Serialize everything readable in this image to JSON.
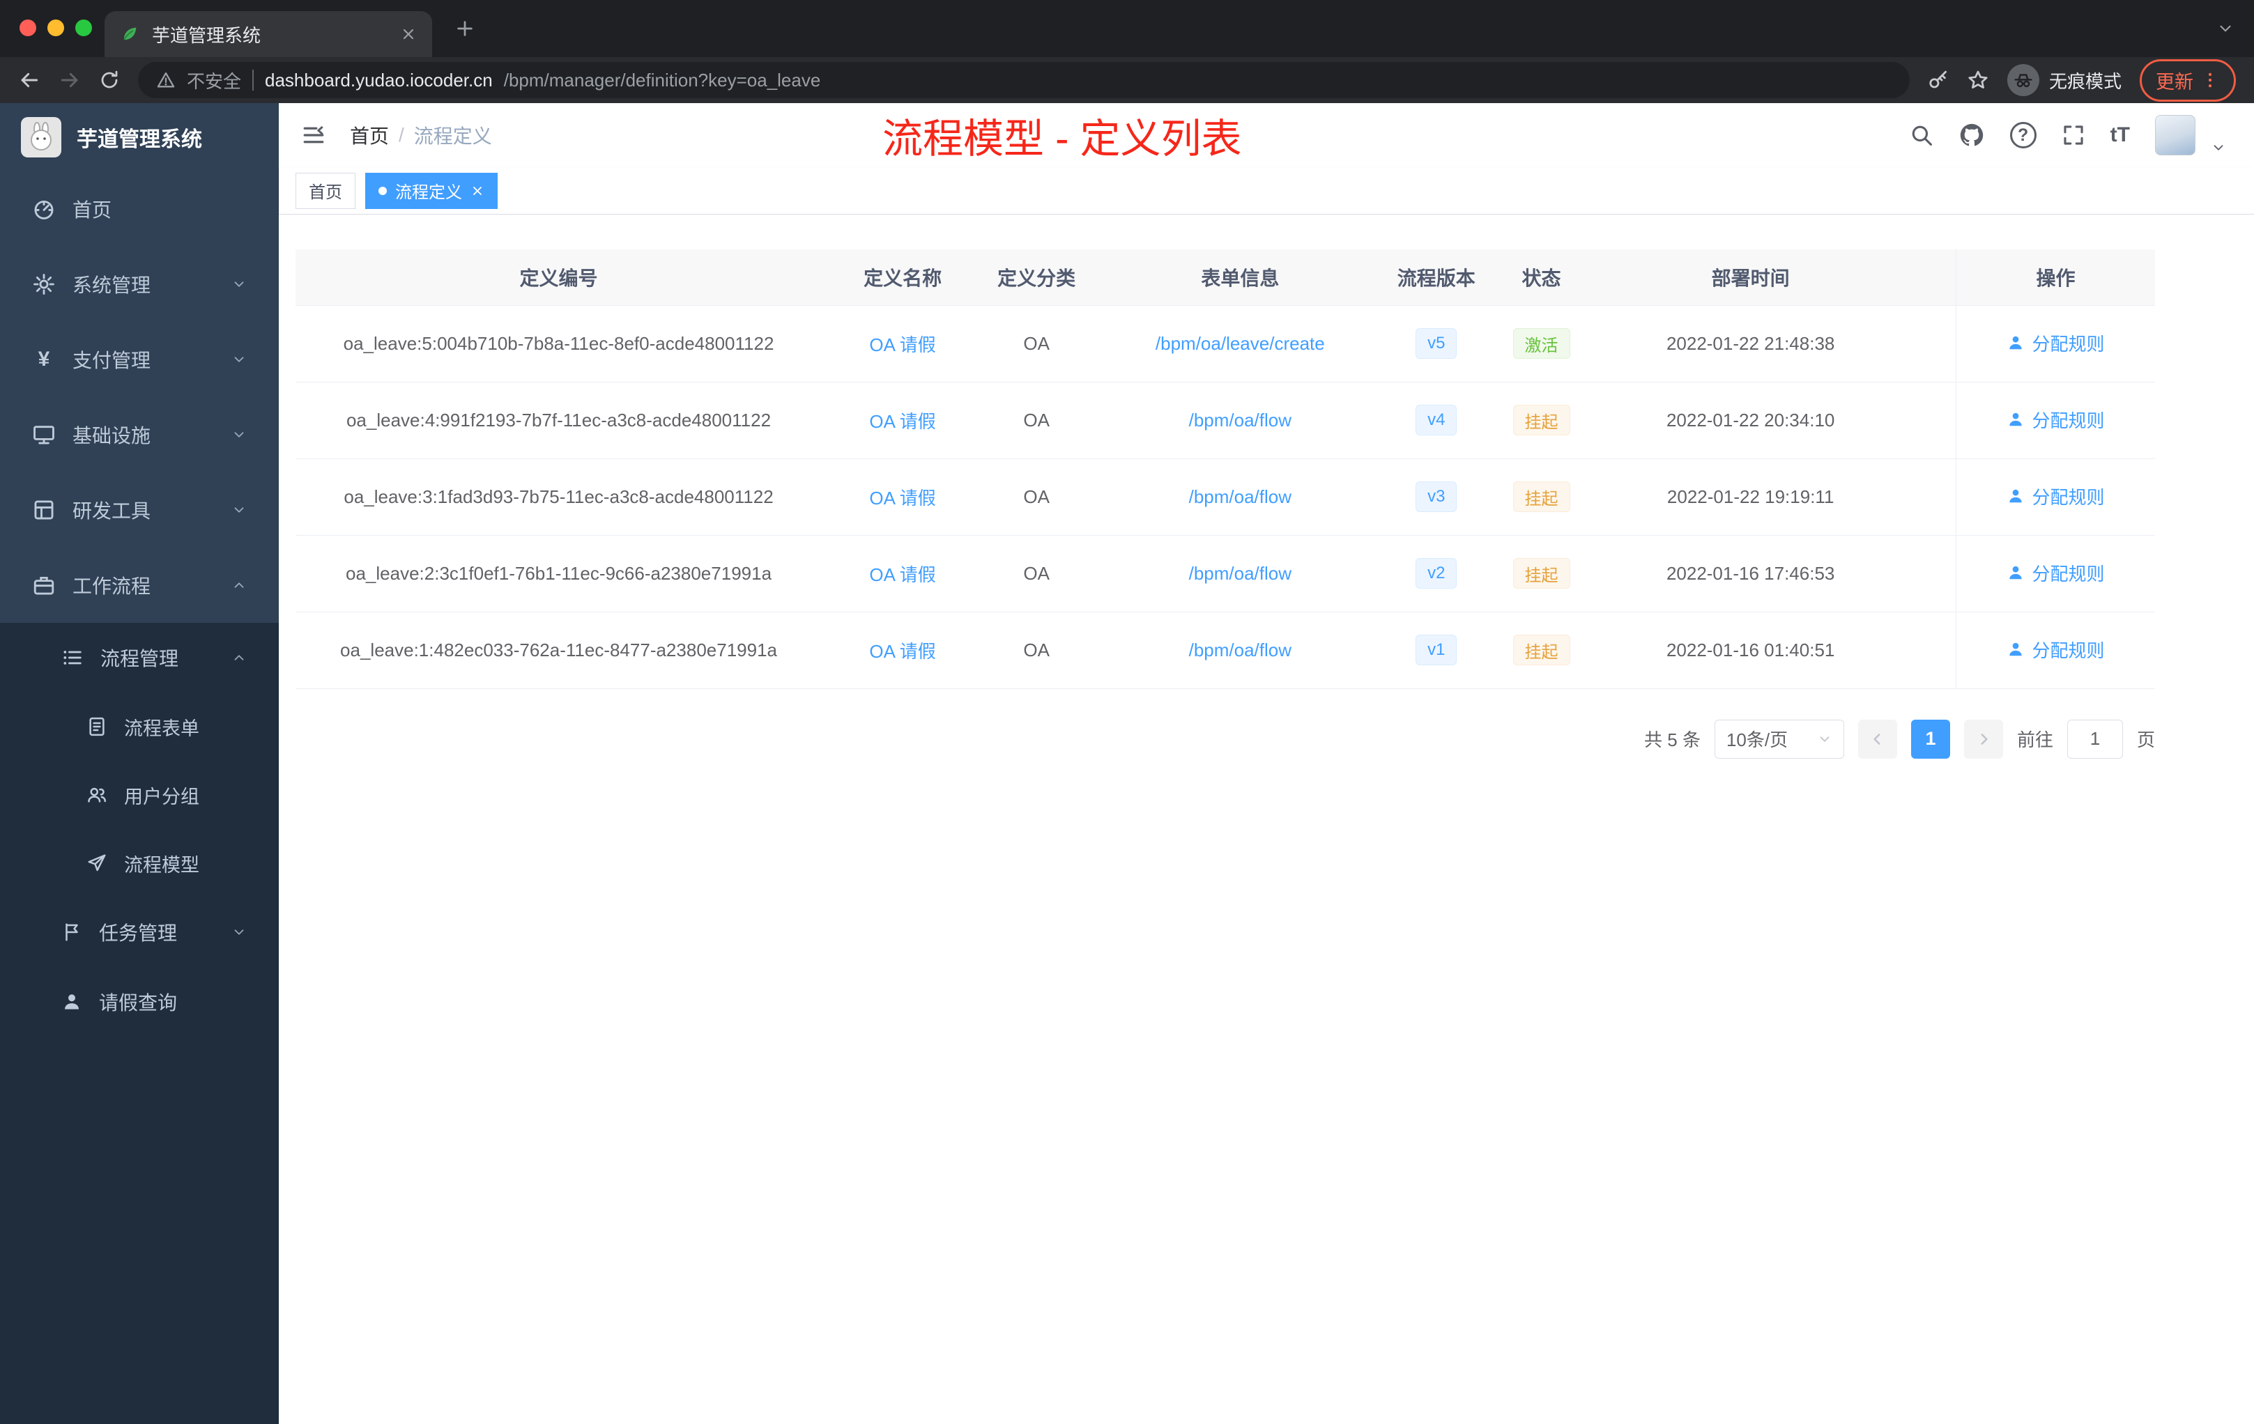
{
  "colors": {
    "accent": "#409eff",
    "success": "#67c23a",
    "warning": "#e6a23c",
    "annotation_red": "#f5271a",
    "sidebar_bg": "#304156",
    "submenu_bg": "#1f2d3d",
    "version_tag": "#409eff"
  },
  "browser": {
    "tab_title": "芋道管理系统",
    "security_label": "不安全",
    "url_host": "dashboard.yudao.iocoder.cn",
    "url_path": "/bpm/manager/definition?key=oa_leave",
    "incognito_label": "无痕模式",
    "update_label": "更新"
  },
  "sidebar": {
    "logo_title": "芋道管理系统",
    "yen_glyph": "¥",
    "items": [
      "首页",
      "系统管理",
      "支付管理",
      "基础设施",
      "研发工具",
      "工作流程",
      "流程管理",
      "流程表单",
      "用户分组",
      "流程模型",
      "任务管理",
      "请假查询"
    ]
  },
  "header": {
    "breadcrumb_home": "首页",
    "breadcrumb_sep": "/",
    "breadcrumb_current": "流程定义",
    "annotation": "流程模型 - 定义列表",
    "font_size_icon_label": "tT"
  },
  "tags": {
    "home": "首页",
    "active": "流程定义"
  },
  "table": {
    "columns": [
      "定义编号",
      "定义名称",
      "定义分类",
      "表单信息",
      "流程版本",
      "状态",
      "部署时间",
      "操作"
    ],
    "action_label": "分配规则",
    "rows": [
      {
        "id": "oa_leave:5:004b710b-7b8a-11ec-8ef0-acde48001122",
        "name": "OA 请假",
        "category": "OA",
        "form": "/bpm/oa/leave/create",
        "version": "v5",
        "status": "激活",
        "status_type": "success",
        "deploy_time": "2022-01-22 21:48:38"
      },
      {
        "id": "oa_leave:4:991f2193-7b7f-11ec-a3c8-acde48001122",
        "name": "OA 请假",
        "category": "OA",
        "form": "/bpm/oa/flow",
        "version": "v4",
        "status": "挂起",
        "status_type": "warning",
        "deploy_time": "2022-01-22 20:34:10"
      },
      {
        "id": "oa_leave:3:1fad3d93-7b75-11ec-a3c8-acde48001122",
        "name": "OA 请假",
        "category": "OA",
        "form": "/bpm/oa/flow",
        "version": "v3",
        "status": "挂起",
        "status_type": "warning",
        "deploy_time": "2022-01-22 19:19:11"
      },
      {
        "id": "oa_leave:2:3c1f0ef1-76b1-11ec-9c66-a2380e71991a",
        "name": "OA 请假",
        "category": "OA",
        "form": "/bpm/oa/flow",
        "version": "v2",
        "status": "挂起",
        "status_type": "warning",
        "deploy_time": "2022-01-16 17:46:53"
      },
      {
        "id": "oa_leave:1:482ec033-762a-11ec-8477-a2380e71991a",
        "name": "OA 请假",
        "category": "OA",
        "form": "/bpm/oa/flow",
        "version": "v1",
        "status": "挂起",
        "status_type": "warning",
        "deploy_time": "2022-01-16 01:40:51"
      }
    ]
  },
  "pagination": {
    "total": "共 5 条",
    "page_size": "10条/页",
    "page": "1",
    "goto_label": "前往",
    "goto_value": "1",
    "unit": "页"
  }
}
